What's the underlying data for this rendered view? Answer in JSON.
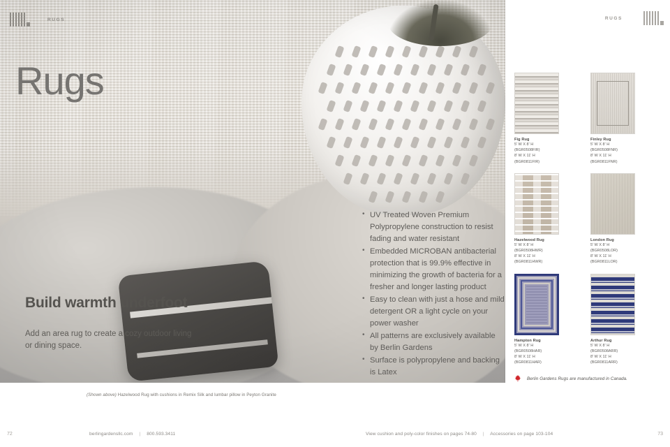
{
  "header": {
    "left_label": "RUGS",
    "right_label": "RUGS",
    "mark_icon": "barcode-mark-icon"
  },
  "hero": {
    "title": "Rugs",
    "headline": "Build warmth underfoot",
    "subhead": "Add an area rug to create a cozy outdoor living or dining space.",
    "caption_prefix": "(Shown above)",
    "caption": "Hazelwood Rug with cushions in Remix Silk and lumbar pillow in Peyton Granite"
  },
  "features": [
    "UV Treated Woven Premium Polypropylene construction to resist fading and water resistant",
    "Embedded MICROBAN antibacterial protection that is 99.9% effective in minimizing the growth of bacteria for a fresher and longer lasting product",
    "Easy to clean with just a hose and mild detergent OR a light cycle on your power washer",
    "All patterns are exclusively available by Berlin Gardens",
    "Surface is polypropylene and backing is Latex"
  ],
  "products": [
    {
      "name": "Fig Rug",
      "size_small": "5' W X 8' H (BGR0508FIR)",
      "size_large": "8' W X 11' H (BGR0811FIR)",
      "swatch": "sw-fig"
    },
    {
      "name": "Finley Rug",
      "size_small": "5' W X 8' H (BGR0508FNR)",
      "size_large": "8' W X 11' H (BGR0811FNR)",
      "swatch": "sw-finley"
    },
    {
      "name": "Hazelwood Rug",
      "size_small": "5' W X 8' H (BGR0508HWR)",
      "size_large": "8' W X 11' H (BGR0811HWR)",
      "swatch": "sw-hazel"
    },
    {
      "name": "London Rug",
      "size_small": "5' W X 8' H (BGR0508LOR)",
      "size_large": "8' W X 11' H (BGR0811LOR)",
      "swatch": "sw-london"
    },
    {
      "name": "Hampton Rug",
      "size_small": "5' W X 8' H (BGR0508HAR)",
      "size_large": "8' W X 11' H (BGR0811HAR)",
      "swatch": "sw-hampton"
    },
    {
      "name": "Arthur Rug",
      "size_small": "5' W X 8' H (BGR0508ARR)",
      "size_large": "8' W X 11' H (BGR0811ARR)",
      "swatch": "sw-arthur"
    }
  ],
  "canada_note": {
    "icon": "maple-leaf-icon",
    "text": "Berlin Gardens Rugs are manufactured in Canada."
  },
  "footer": {
    "page_left": "72",
    "page_right": "73",
    "website": "berlingardensllc.com",
    "phone": "800.593.3411",
    "note_finishes": "View cushion and poly-color finishes on pages 74-80",
    "note_accessories": "Accessories on page 103-104",
    "separator": "|"
  },
  "colors": {
    "navy": "#2f3a7a",
    "maple_red": "#d0262b",
    "text_dark": "#4c4a47",
    "text_muted": "#8c8985"
  }
}
